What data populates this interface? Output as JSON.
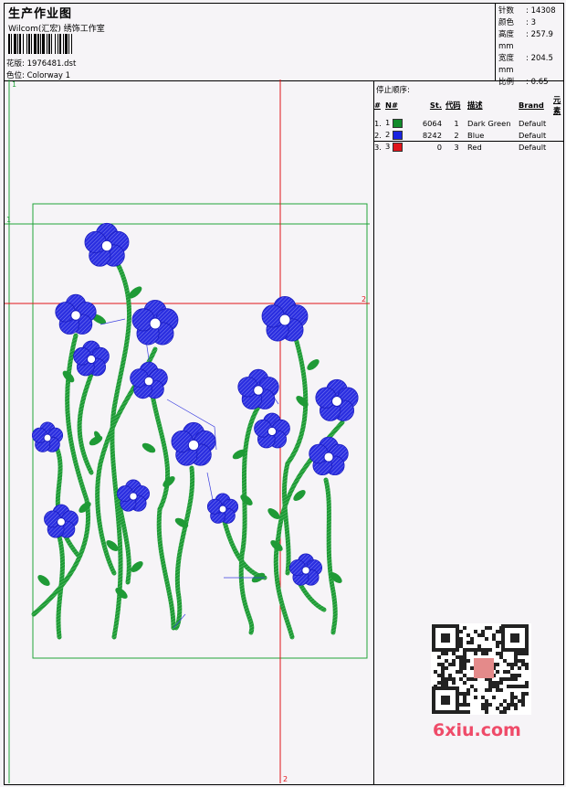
{
  "header": {
    "title": "生产作业图",
    "company": "Wilcom(汇宏) 绣饰工作室",
    "design_label": "花版: 1976481.dst",
    "colorway_label": "色位: Colorway 1"
  },
  "stats": [
    {
      "key": "针数",
      "value": "14308"
    },
    {
      "key": "颜色",
      "value": "3"
    },
    {
      "key": "高度",
      "value": "257.9 mm"
    },
    {
      "key": "宽度",
      "value": "204.5 mm"
    },
    {
      "key": "比例",
      "value": "0.65"
    }
  ],
  "stop_sequence": {
    "title": "停止顺序:",
    "headers": [
      "#",
      "N#",
      "St.",
      "代码",
      "描述",
      "Brand",
      "元素"
    ],
    "rows": [
      {
        "idx": "1.",
        "n": "1",
        "color": "#118a2a",
        "stitches": "6064",
        "code": "1",
        "desc": "Dark Green",
        "brand": "Default"
      },
      {
        "idx": "2.",
        "n": "2",
        "color": "#1a24e0",
        "stitches": "8242",
        "code": "2",
        "desc": "Blue",
        "brand": "Default"
      },
      {
        "idx": "3.",
        "n": "3",
        "color": "#e0141a",
        "stitches": "0",
        "code": "3",
        "desc": "Red",
        "brand": "Default"
      }
    ]
  },
  "guides": {
    "green_marker_1": "1",
    "green_marker_2": "1",
    "red_marker_h": "2",
    "red_marker_v": "2"
  },
  "watermark": {
    "site": "6xiu.com"
  },
  "colors": {
    "green": "#21a33a",
    "blue": "#1f22d6",
    "red": "#e0141a"
  }
}
